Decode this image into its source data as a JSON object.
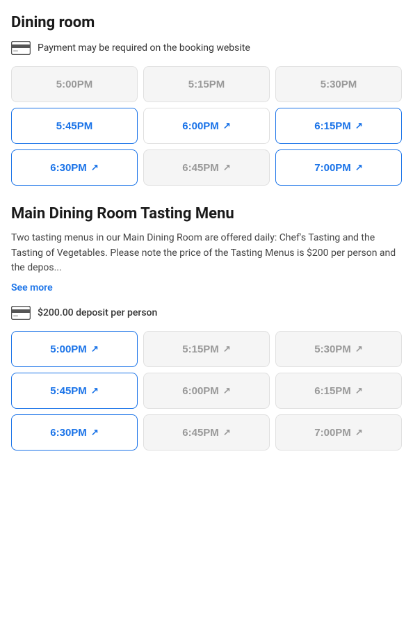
{
  "dining_room": {
    "title": "Dining room",
    "payment_notice": "Payment may be required on the booking website",
    "time_slots": [
      {
        "time": "5:00PM",
        "state": "unavailable",
        "external": false
      },
      {
        "time": "5:15PM",
        "state": "unavailable",
        "external": false
      },
      {
        "time": "5:30PM",
        "state": "unavailable",
        "external": false
      },
      {
        "time": "5:45PM",
        "state": "available",
        "external": false
      },
      {
        "time": "6:00PM",
        "state": "external",
        "external": true
      },
      {
        "time": "6:15PM",
        "state": "available",
        "external": true
      },
      {
        "time": "6:30PM",
        "state": "available",
        "external": true
      },
      {
        "time": "6:45PM",
        "state": "external",
        "external": true
      },
      {
        "time": "7:00PM",
        "state": "available",
        "external": true
      }
    ]
  },
  "tasting_menu": {
    "title": "Main Dining Room Tasting Menu",
    "description": "Two tasting menus in our Main Dining Room are offered daily: Chef's Tasting and the Tasting of Vegetables. Please note the price of the Tasting Menus is $200 per person and the depos...",
    "see_more_label": "See more",
    "deposit_notice": "$200.00 deposit per person",
    "time_slots": [
      {
        "time": "5:00PM",
        "state": "available",
        "external": true
      },
      {
        "time": "5:15PM",
        "state": "unavailable",
        "external": true
      },
      {
        "time": "5:30PM",
        "state": "unavailable",
        "external": true
      },
      {
        "time": "5:45PM",
        "state": "available",
        "external": true
      },
      {
        "time": "6:00PM",
        "state": "unavailable",
        "external": true
      },
      {
        "time": "6:15PM",
        "state": "unavailable",
        "external": true
      },
      {
        "time": "6:30PM",
        "state": "available",
        "external": true
      },
      {
        "time": "6:45PM",
        "state": "unavailable",
        "external": true
      },
      {
        "time": "7:00PM",
        "state": "unavailable",
        "external": true
      }
    ]
  },
  "colors": {
    "available_blue": "#1a73e8",
    "unavailable_gray": "#999999",
    "background": "#ffffff"
  }
}
